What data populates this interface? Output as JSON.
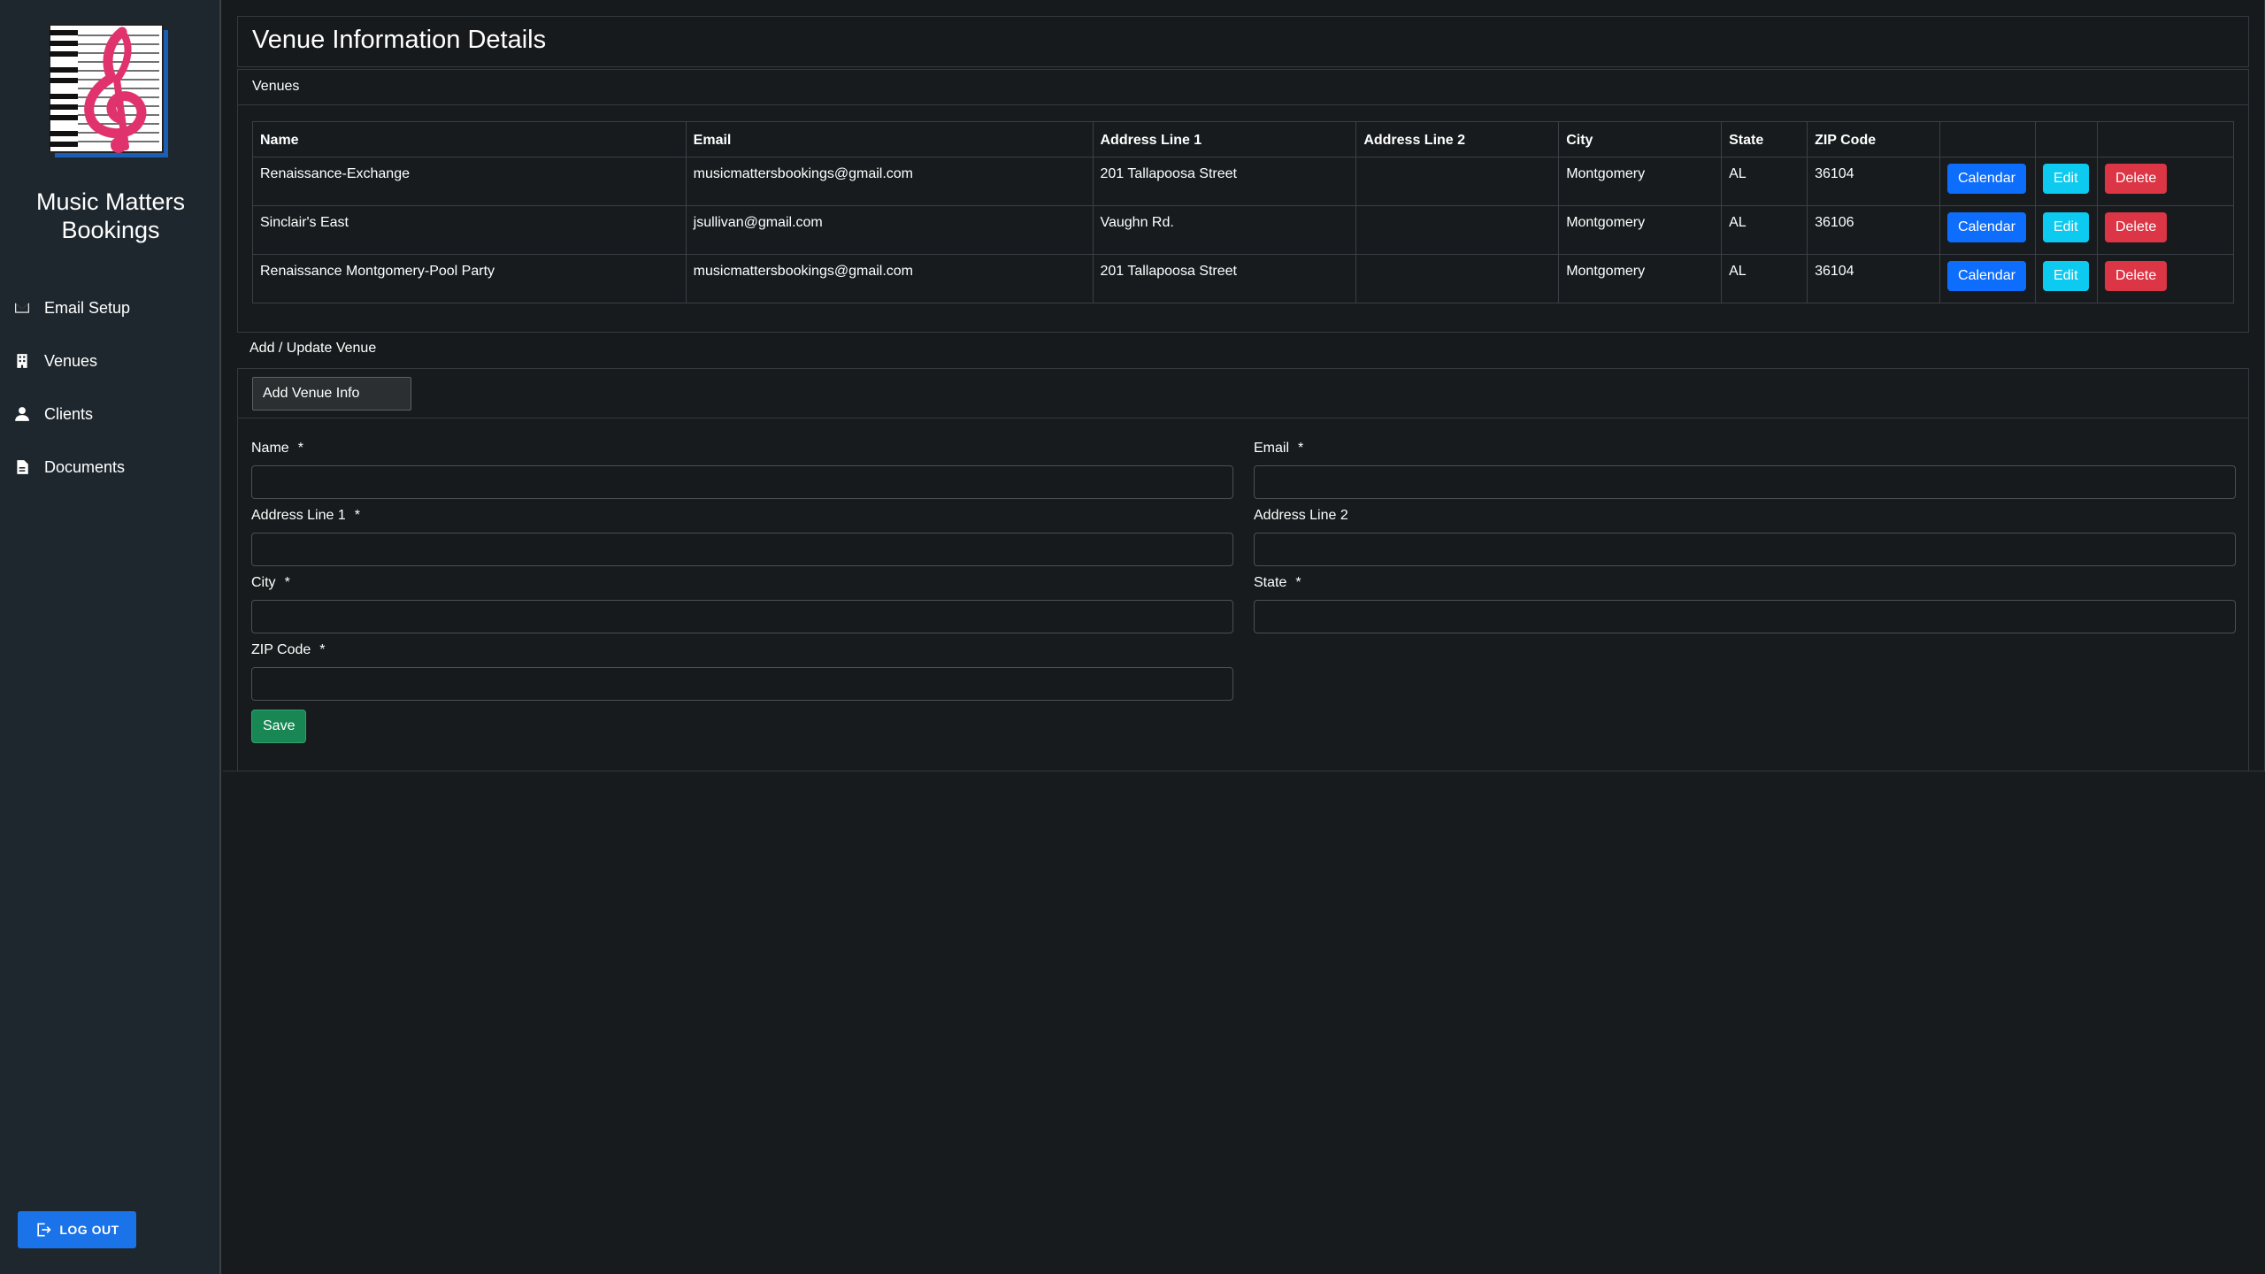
{
  "sidebar": {
    "brand": "Music Matters Bookings",
    "nav": [
      {
        "label": "Email Setup",
        "icon": "envelope-icon"
      },
      {
        "label": "Venues",
        "icon": "building-icon"
      },
      {
        "label": "Clients",
        "icon": "person-icon"
      },
      {
        "label": "Documents",
        "icon": "document-icon"
      }
    ],
    "logout_label": "LOG OUT"
  },
  "page": {
    "title": "Venue Information Details"
  },
  "venues": {
    "header": "Venues",
    "columns": [
      "Name",
      "Email",
      "Address Line 1",
      "Address Line 2",
      "City",
      "State",
      "ZIP Code",
      "",
      "",
      ""
    ],
    "rows": [
      {
        "name": "Renaissance-Exchange",
        "email": "musicmattersbookings@gmail.com",
        "address1": "201 Tallapoosa Street",
        "address2": "",
        "city": "Montgomery",
        "state": "AL",
        "zip": "36104"
      },
      {
        "name": "Sinclair's East",
        "email": "jsullivan@gmail.com",
        "address1": "Vaughn Rd.",
        "address2": "",
        "city": "Montgomery",
        "state": "AL",
        "zip": "36106"
      },
      {
        "name": "Renaissance Montgomery-Pool Party",
        "email": "musicmattersbookings@gmail.com",
        "address1": "201 Tallapoosa Street",
        "address2": "",
        "city": "Montgomery",
        "state": "AL",
        "zip": "36104"
      }
    ],
    "actions": {
      "calendar": "Calendar",
      "edit": "Edit",
      "delete": "Delete"
    }
  },
  "form": {
    "section_title": "Add / Update Venue",
    "tab_label": "Add Venue Info",
    "required_mark": "*",
    "fields": {
      "name": {
        "label": "Name",
        "value": ""
      },
      "email": {
        "label": "Email",
        "value": ""
      },
      "address1": {
        "label": "Address Line 1",
        "value": ""
      },
      "address2": {
        "label": "Address Line 2",
        "value": ""
      },
      "city": {
        "label": "City",
        "value": ""
      },
      "state": {
        "label": "State",
        "value": ""
      },
      "zip": {
        "label": "ZIP Code",
        "value": ""
      }
    },
    "save_label": "Save"
  },
  "colors": {
    "primary": "#0d6efd",
    "info": "#0dcaf0",
    "danger": "#dc3545",
    "success": "#198754",
    "logo_accent": "#e0336e"
  }
}
